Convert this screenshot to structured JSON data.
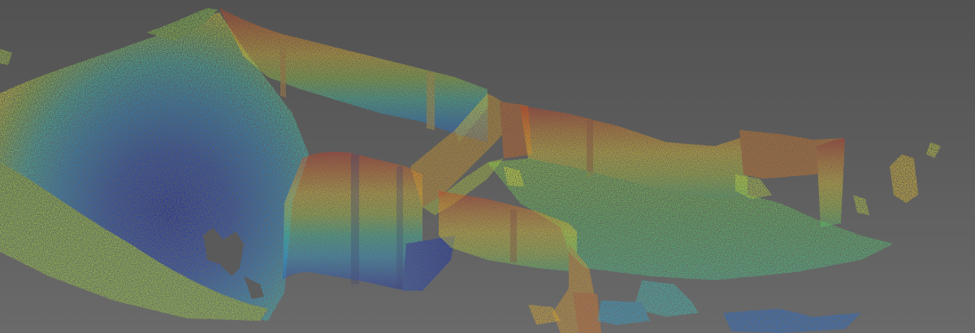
{
  "viewer": {
    "background_top": "#525252",
    "background_bottom": "#6a6a6a"
  },
  "colormap": {
    "name": "height-jet",
    "stops": [
      "#0a1fb8",
      "#1d7fe0",
      "#28c8d8",
      "#4cd08a",
      "#b8d83a",
      "#f3d22a",
      "#f08a1e",
      "#d8321a"
    ]
  }
}
